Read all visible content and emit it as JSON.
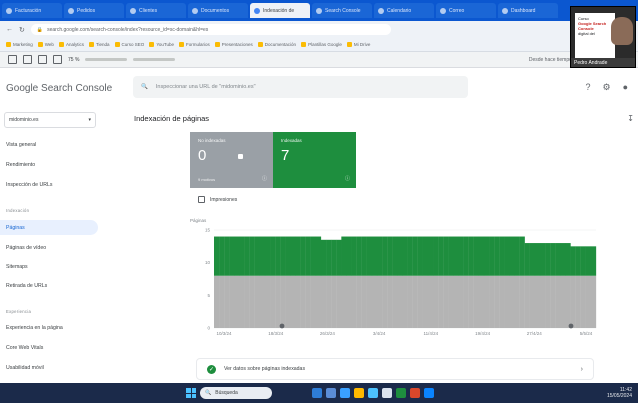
{
  "browser": {
    "tabs": [
      {
        "label": "Facturación",
        "active": false
      },
      {
        "label": "Pedidos",
        "active": false
      },
      {
        "label": "Clientes",
        "active": false
      },
      {
        "label": "Documentos",
        "active": false
      },
      {
        "label": "Indexación de",
        "active": true
      },
      {
        "label": "Search Console",
        "active": false
      },
      {
        "label": "Calendario",
        "active": false
      },
      {
        "label": "Correo",
        "active": false
      },
      {
        "label": "Dashboard",
        "active": false
      }
    ],
    "url": "search.google.com/search-console/index?resource_id=sc-domain&hl=es",
    "bookmarks": [
      "Marketing",
      "Web",
      "Analytics",
      "Tienda",
      "Curso SEO",
      "YouTube",
      "Formularios",
      "Presentaciones",
      "Documentación",
      "Plantillas Google",
      "Mi Drive"
    ]
  },
  "doc_toolbar": {
    "zoom": "75 %",
    "right_text": "Desde hace tiempo, este alojamiento es lento"
  },
  "webcam": {
    "slide_line1": "Curso",
    "slide_line2": "Google Search",
    "slide_line3": "Console",
    "slide_line4": "digital del",
    "nametag": "Pedro Andrade"
  },
  "header": {
    "brand": "Google Search Console",
    "search_placeholder": "Inspeccionar una URL de \"midominio.es\""
  },
  "sidebar": {
    "property": "midominio.es",
    "items": [
      {
        "label": "Vista general",
        "top": 29
      },
      {
        "label": "Rendimiento",
        "top": 49
      },
      {
        "label": "Inspección de URLs",
        "top": 69
      }
    ],
    "section_index": "Indexación",
    "index_items": [
      {
        "label": "Páginas",
        "active": true
      },
      {
        "label": "Páginas de vídeo",
        "active": false
      },
      {
        "label": "Sitemaps",
        "active": false
      },
      {
        "label": "Retirada de URLs",
        "active": false
      }
    ],
    "section_exp": "Experiencia",
    "exp_items": [
      {
        "label": "Experiencia en la página"
      },
      {
        "label": "Core Web Vitals"
      },
      {
        "label": "Usabilidad móvil"
      }
    ]
  },
  "main": {
    "title": "Indexación de páginas",
    "tile_not_indexed": {
      "label": "No indexadas",
      "count": "0",
      "sub": "9 motivos"
    },
    "tile_indexed": {
      "label": "Indexadas",
      "count": "7"
    },
    "impressions_label": "Impresiones",
    "summary_text": "Ver datos sobre páginas indexadas"
  },
  "chart_data": {
    "type": "bar",
    "ylabel": "Páginas",
    "ylim": [
      0,
      15
    ],
    "yticks": [
      0,
      5,
      10,
      15
    ],
    "x_labels": [
      "10/3/24",
      "18/3/24",
      "26/3/24",
      "3/4/24",
      "11/4/24",
      "19/4/24",
      "27/4/24",
      "5/5/24"
    ],
    "series": [
      {
        "name": "No indexadas",
        "color": "#b4b4b4",
        "values": [
          8,
          8,
          8,
          8,
          8,
          8,
          8,
          8,
          8,
          8,
          8,
          8,
          8,
          8,
          8,
          8,
          8,
          8,
          8,
          8,
          8,
          8,
          8,
          8,
          8,
          8,
          8,
          8,
          8,
          8,
          8,
          8,
          8,
          8,
          8,
          8,
          8,
          8,
          8,
          8,
          8,
          8,
          8,
          8,
          8,
          8,
          8,
          8,
          8,
          8,
          8,
          8,
          8,
          8,
          8,
          8,
          8,
          8,
          8,
          8,
          8,
          8,
          8,
          8,
          8,
          8,
          8,
          8,
          8,
          8,
          8,
          8,
          8,
          8,
          8
        ]
      },
      {
        "name": "Indexadas",
        "color": "#1e8e3e",
        "values": [
          6,
          6,
          6,
          6,
          6,
          6,
          6,
          6,
          6,
          6,
          6,
          6,
          6,
          6,
          6,
          6,
          6,
          6,
          6,
          6,
          6,
          5.5,
          5.5,
          5.5,
          5.5,
          6,
          6,
          6,
          6,
          6,
          6,
          6,
          6,
          6,
          6,
          6,
          6,
          6,
          6,
          6,
          6,
          6,
          6,
          6,
          6,
          6,
          6,
          6,
          6,
          6,
          6,
          6,
          6,
          6,
          6,
          6,
          6,
          6,
          6,
          6,
          6,
          5,
          5,
          5,
          5,
          5,
          5,
          5,
          5,
          5,
          4.5,
          4.5,
          4.5,
          4.5,
          4.5
        ]
      }
    ],
    "colors": {
      "not_indexed": "#9aa0a6",
      "indexed": "#1e8e3e"
    }
  },
  "taskbar": {
    "search_label": "Búsqueda",
    "time": "11:42",
    "date": "15/05/2024"
  }
}
